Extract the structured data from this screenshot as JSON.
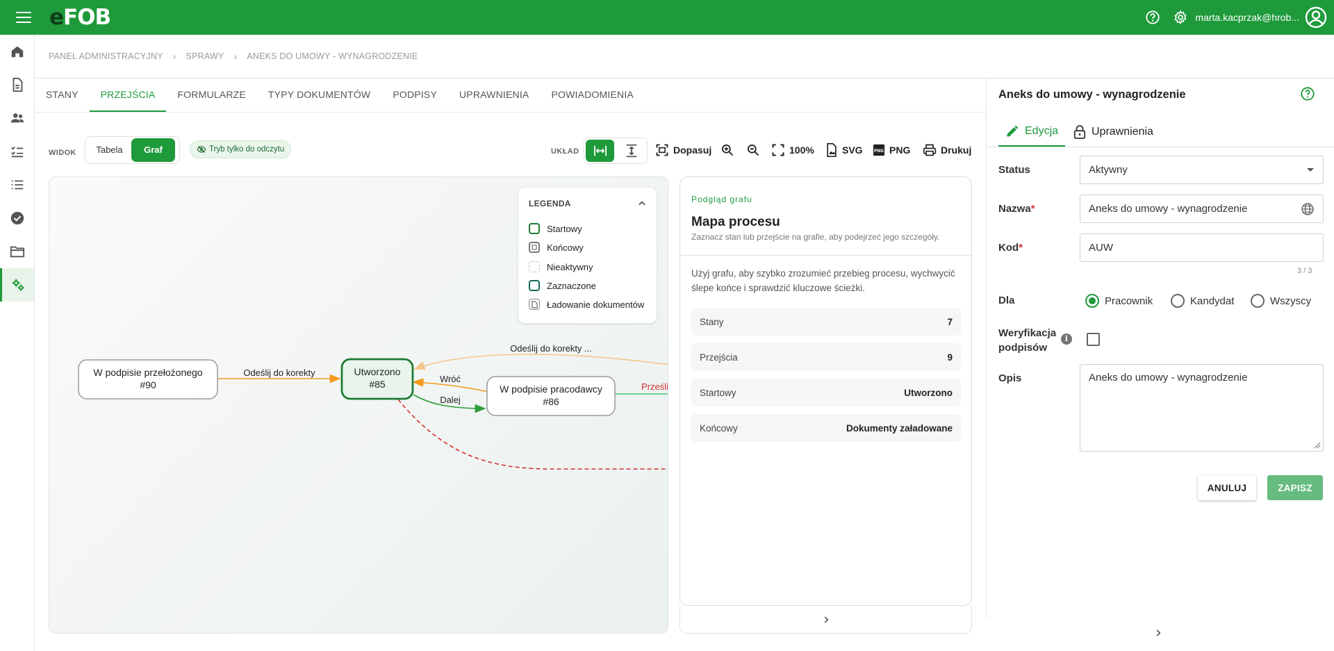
{
  "app": {
    "logo_e": "e",
    "logo_rest": "FOB",
    "user_email": "marta.kacprzak@hrob...",
    "brand_color": "#1e9a3b"
  },
  "sidebar": {
    "items": [
      {
        "icon": "home-icon"
      },
      {
        "icon": "document-icon"
      },
      {
        "icon": "people-icon"
      },
      {
        "icon": "checklist-icon"
      },
      {
        "icon": "list-icon"
      },
      {
        "icon": "check-circle-icon"
      },
      {
        "icon": "folder-icon"
      },
      {
        "icon": "admin-settings-icon",
        "active": true
      }
    ]
  },
  "breadcrumb": [
    "PANEL ADMINISTRACYJNY",
    "SPRAWY",
    "ANEKS DO UMOWY - WYNAGRODZENIE"
  ],
  "tabs": [
    {
      "label": "STANY"
    },
    {
      "label": "PRZEJŚCIA",
      "active": true
    },
    {
      "label": "FORMULARZE"
    },
    {
      "label": "TYPY DOKUMENTÓW"
    },
    {
      "label": "PODPISY"
    },
    {
      "label": "UPRAWNIENIA"
    },
    {
      "label": "POWIADOMIENIA"
    }
  ],
  "toolbar": {
    "widok_label": "WIDOK",
    "view_table": "Tabela",
    "view_graph": "Graf",
    "readonly_chip": "Tryb tylko do odczytu",
    "uklad_label": "UKŁAD",
    "fit": "Dopasuj",
    "zoom_level": "100%",
    "svg": "SVG",
    "png": "PNG",
    "print": "Drukuj"
  },
  "legend": {
    "title": "LEGENDA",
    "items": [
      {
        "label": "Startowy",
        "kind": "start"
      },
      {
        "label": "Końcowy",
        "kind": "end"
      },
      {
        "label": "Nieaktywny",
        "kind": "inactive"
      },
      {
        "label": "Zaznaczone",
        "kind": "selected"
      },
      {
        "label": "Ładowanie dokumentów",
        "kind": "docs"
      }
    ]
  },
  "graph": {
    "nodes": [
      {
        "id": "n90",
        "line1": "W podpisie przełożonego",
        "line2": "#90"
      },
      {
        "id": "n85",
        "line1": "Utworzono",
        "line2": "#85",
        "start": true
      },
      {
        "id": "n86",
        "line1": "W podpisie pracodawcy",
        "line2": "#86"
      }
    ],
    "edges": [
      {
        "label": "Odeślij do korekty",
        "color": "#f59a1c"
      },
      {
        "label": "Wróć",
        "color": "#f59a1c"
      },
      {
        "label": "Dalej",
        "color": "#2e9e3a"
      },
      {
        "label": "Odeślij do korekty ...",
        "color": "#f7c48a"
      },
      {
        "label": "Prześli",
        "color": "#d32f2f"
      }
    ]
  },
  "preview": {
    "kicker": "Podgląd grafu",
    "title": "Mapa procesu",
    "subtitle": "Zaznacz stan lub przejście na grafie, aby podejrzeć jego szczegóły.",
    "description": "Użyj grafu, aby szybko zrozumieć przebieg procesu, wychwycić ślepe końce i sprawdzić kluczowe ścieżki.",
    "stats": [
      {
        "label": "Stany",
        "value": "7"
      },
      {
        "label": "Przejścia",
        "value": "9"
      },
      {
        "label": "Startowy",
        "value": "Utworzono"
      },
      {
        "label": "Końcowy",
        "value": "Dokumenty załadowane"
      }
    ]
  },
  "right_panel": {
    "title": "Aneks do umowy - wynagrodzenie",
    "tab_edit": "Edycja",
    "tab_perms": "Uprawnienia",
    "status_label": "Status",
    "status_value": "Aktywny",
    "name_label": "Nazwa",
    "name_value": "Aneks do umowy - wynagrodzenie",
    "code_label": "Kod",
    "code_value": "AUW",
    "code_counter": "3 / 3",
    "dla_label": "Dla",
    "dla_options": [
      {
        "label": "Pracownik",
        "selected": true
      },
      {
        "label": "Kandydat",
        "selected": false
      },
      {
        "label": "Wszyscy",
        "selected": false
      }
    ],
    "verify_label_1": "Weryfikacja",
    "verify_label_2": "podpisów",
    "desc_label": "Opis",
    "desc_value": "Aneks do umowy - wynagrodzenie",
    "cancel": "ANULUJ",
    "save": "ZAPISZ",
    "required_mark": "*"
  }
}
